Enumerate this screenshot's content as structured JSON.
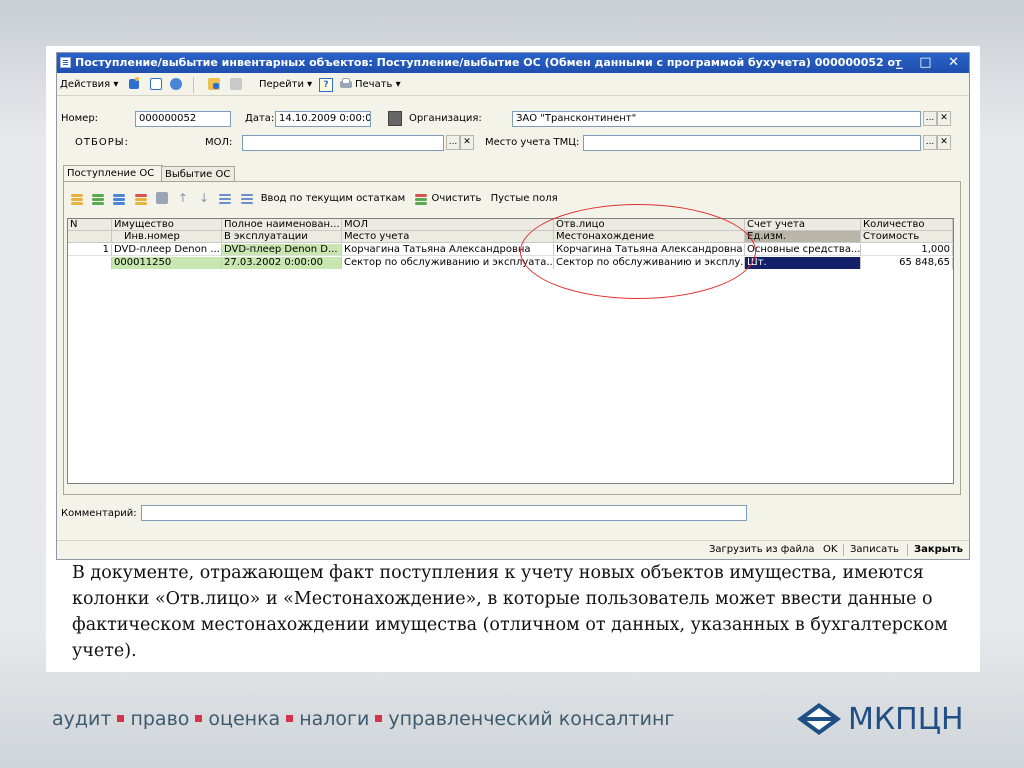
{
  "window": {
    "title": "Поступление/выбытие инвентарных объектов: Поступление/выбытие ОС (Обмен данными с программой бухучета) 000000052 от 1...:00 *",
    "controls": "_ □ ✕"
  },
  "toolbar": {
    "actions": "Действия ▾",
    "goto": "Перейти ▾",
    "help": "?",
    "print": "Печать ▾"
  },
  "form": {
    "number_label": "Номер:",
    "number": "000000052",
    "date_label": "Дата:",
    "date": "14.10.2009  0:00:00",
    "org_label": "Организация:",
    "org": "ЗАО \"Трансконтинент\"",
    "filters_label": "ОТБОРЫ:",
    "mol_label": "МОЛ:",
    "mol": "",
    "place_label": "Место учета ТМЦ:",
    "place": "",
    "more": "...",
    "clear": "✕"
  },
  "tabs": [
    {
      "label": "Поступление ОС"
    },
    {
      "label": "Выбытие ОС"
    }
  ],
  "panel_toolbar": {
    "balances": "Ввод по текущим остаткам",
    "clear": "Очистить",
    "empty_fields": "Пустые поля"
  },
  "grid": {
    "header1": [
      "N",
      "Имущество",
      "Полное наименован...",
      "МОЛ",
      "Отв.лицо",
      "Счет учета",
      "Количество"
    ],
    "header2": [
      "",
      "Инв.номер",
      "В эксплуатации",
      "Место учета",
      "Местонахождение",
      "Ед.изм.",
      "Стоимость"
    ],
    "row1": [
      "1",
      "DVD-плеер Denon ...",
      "DVD-плеер Denon D...",
      "Корчагина Татьяна Александровна",
      "Корчагина Татьяна Александровна",
      "Основные средства...",
      "1,000"
    ],
    "row2": [
      "",
      "000011250",
      "27.03.2002 0:00:00",
      "Сектор по обслуживанию и эксплуата...",
      "Сектор по обслуживанию и эксплу...",
      "Шт.",
      "65 848,65"
    ]
  },
  "comment": {
    "label": "Комментарий:",
    "value": ""
  },
  "bottombar": {
    "load": "Загрузить из файла",
    "ok": "OK",
    "save": "Записать",
    "close": "Закрыть"
  },
  "caption": "В документе, отражающем факт поступления к учету новых объектов имущества, имеются колонки «Отв.лицо» и «Местонахождение», в которые пользователь может ввести данные о фактическом местонахождении имущества (отличном от данных, указанных в бухгалтерском учете).",
  "footer": {
    "items": [
      "аудит",
      "право",
      "оценка",
      "налоги",
      "управленческий консалтинг"
    ],
    "logo": "МКПЦН"
  },
  "colors": {
    "accent": "#2a62c8",
    "annotation": "#e03030",
    "selected_cell": "#14206a",
    "row_highlight": "#c8e6b0",
    "footer_dot": "#d2354b",
    "logo": "#1f4f84"
  }
}
